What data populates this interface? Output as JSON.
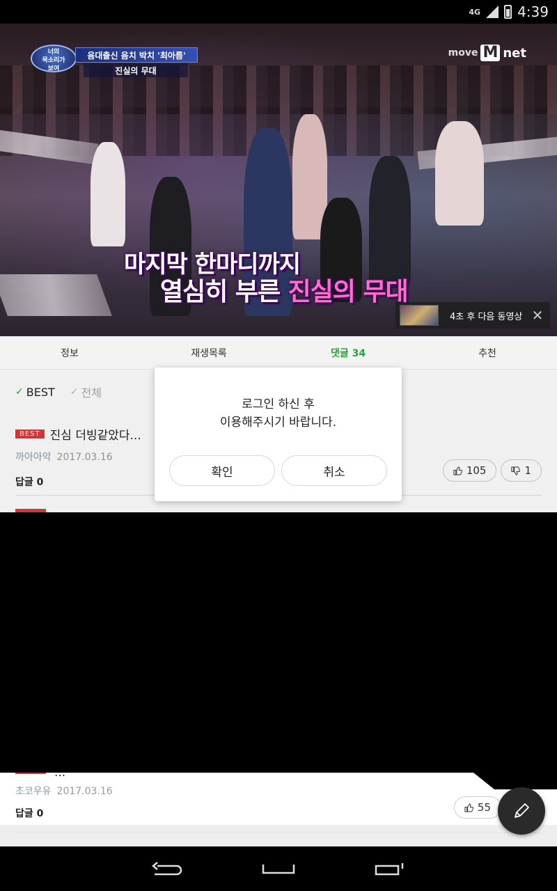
{
  "status_bar": {
    "network": "4G",
    "time": "4:39"
  },
  "video": {
    "show_logo_text": "너의\n목소리가\n보여",
    "caption_top": "음대출신 음치 박치 '최아름'",
    "caption_sub": "진실의 무대",
    "channel": {
      "prefix": "move",
      "m": "M",
      "suffix": "net"
    },
    "subtitle_line1": "마지막 한마디까지",
    "subtitle_line2_white": "열심히 부른 ",
    "subtitle_line2_pink": "진실의 무대",
    "next_video_label": "4초 후 다음 동영상",
    "close_glyph": "✕"
  },
  "tabs": [
    {
      "label": "정보"
    },
    {
      "label": "재생목록"
    },
    {
      "label": "댓글 34"
    },
    {
      "label": "추천"
    }
  ],
  "filters": {
    "best": "BEST",
    "all": "전체",
    "check": "✓"
  },
  "comments": [
    {
      "badge": "BEST",
      "text": "진심 더빙같았다...",
      "author": "까아아악",
      "date": "2017.03.16",
      "reply": "답글 0",
      "likes": "105",
      "dislikes": "1"
    },
    {
      "text": "...",
      "author": "초코우유",
      "date": "2017.03.16",
      "reply": "답글 0",
      "likes": "55"
    }
  ],
  "dialog": {
    "line1": "로그인 하신 후",
    "line2": "이용해주시기 바랍니다.",
    "ok": "확인",
    "cancel": "취소"
  },
  "colors": {
    "accent_green": "#27a33a",
    "best_red": "#e03a3a"
  }
}
